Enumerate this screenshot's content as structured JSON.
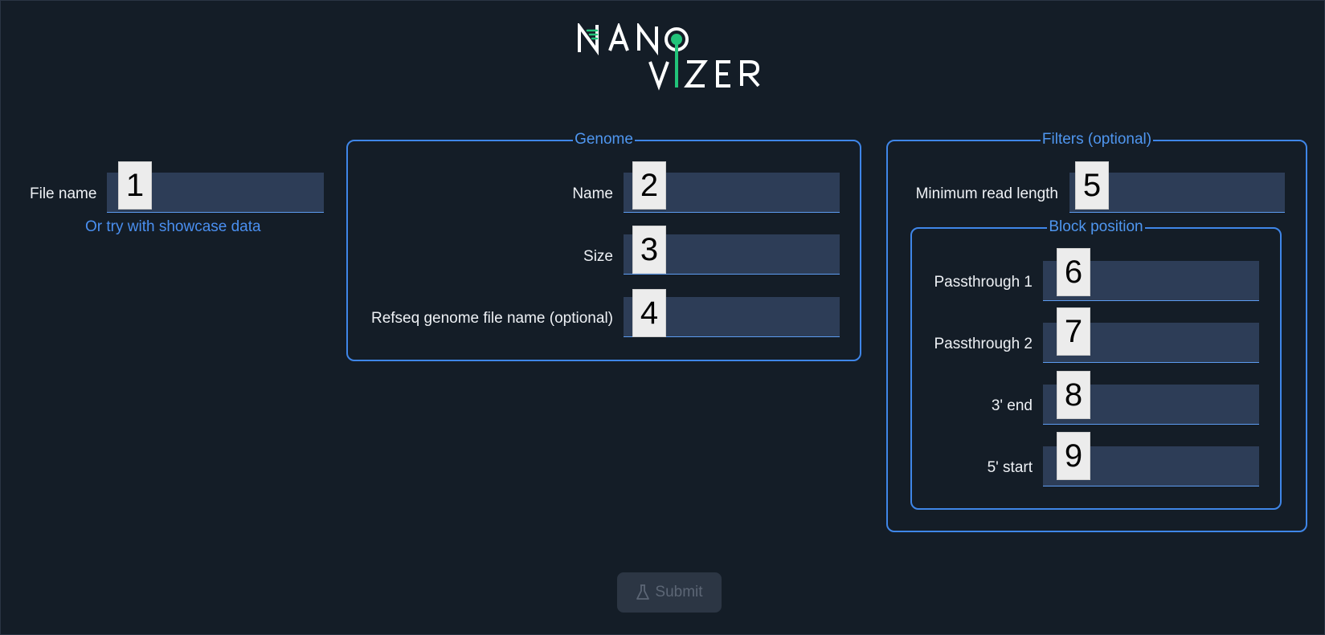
{
  "logo": {
    "line1": "NANO",
    "line2": "VIZER",
    "accent_color": "#22c37a"
  },
  "file": {
    "label": "File name",
    "marker": "1",
    "value": "",
    "showcase_link": "Or try with showcase data"
  },
  "genome": {
    "legend": "Genome",
    "name_label": "Name",
    "name_marker": "2",
    "size_label": "Size",
    "size_marker": "3",
    "refseq_label": "Refseq genome file name (optional)",
    "refseq_marker": "4"
  },
  "filters": {
    "legend": "Filters (optional)",
    "min_read_label": "Minimum read length",
    "min_read_marker": "5",
    "block": {
      "legend": "Block position",
      "pass1_label": "Passthrough 1",
      "pass1_marker": "6",
      "pass2_label": "Passthrough 2",
      "pass2_marker": "7",
      "end3_label": "3' end",
      "end3_marker": "8",
      "start5_label": "5' start",
      "start5_marker": "9"
    }
  },
  "submit": {
    "label": "Submit",
    "icon": "flask-icon",
    "disabled": true
  },
  "colors": {
    "background": "#141d27",
    "accent": "#3f86e8",
    "input_bg": "#2d3d57",
    "logo_green": "#22c37a"
  }
}
